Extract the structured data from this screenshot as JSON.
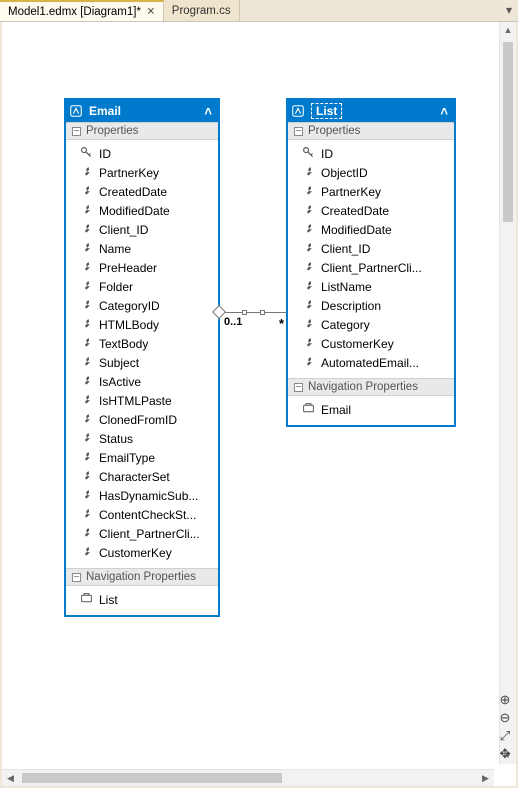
{
  "tabs": {
    "active": "Model1.edmx [Diagram1]*",
    "inactive": "Program.cs"
  },
  "entity_email": {
    "title": "Email",
    "section_props": "Properties",
    "section_nav": "Navigation Properties",
    "props": [
      {
        "icon": "key",
        "name": "ID"
      },
      {
        "icon": "wrench",
        "name": "PartnerKey"
      },
      {
        "icon": "wrench",
        "name": "CreatedDate"
      },
      {
        "icon": "wrench",
        "name": "ModifiedDate"
      },
      {
        "icon": "wrench",
        "name": "Client_ID"
      },
      {
        "icon": "wrench",
        "name": "Name"
      },
      {
        "icon": "wrench",
        "name": "PreHeader"
      },
      {
        "icon": "wrench",
        "name": "Folder"
      },
      {
        "icon": "wrench",
        "name": "CategoryID"
      },
      {
        "icon": "wrench",
        "name": "HTMLBody"
      },
      {
        "icon": "wrench",
        "name": "TextBody"
      },
      {
        "icon": "wrench",
        "name": "Subject"
      },
      {
        "icon": "wrench",
        "name": "IsActive"
      },
      {
        "icon": "wrench",
        "name": "IsHTMLPaste"
      },
      {
        "icon": "wrench",
        "name": "ClonedFromID"
      },
      {
        "icon": "wrench",
        "name": "Status"
      },
      {
        "icon": "wrench",
        "name": "EmailType"
      },
      {
        "icon": "wrench",
        "name": "CharacterSet"
      },
      {
        "icon": "wrench",
        "name": "HasDynamicSub..."
      },
      {
        "icon": "wrench",
        "name": "ContentCheckSt..."
      },
      {
        "icon": "wrench",
        "name": "Client_PartnerCli..."
      },
      {
        "icon": "wrench",
        "name": "CustomerKey"
      }
    ],
    "nav": [
      {
        "name": "List"
      }
    ]
  },
  "entity_list": {
    "title": "List",
    "section_props": "Properties",
    "section_nav": "Navigation Properties",
    "props": [
      {
        "icon": "key",
        "name": "ID"
      },
      {
        "icon": "wrench",
        "name": "ObjectID"
      },
      {
        "icon": "wrench",
        "name": "PartnerKey"
      },
      {
        "icon": "wrench",
        "name": "CreatedDate"
      },
      {
        "icon": "wrench",
        "name": "ModifiedDate"
      },
      {
        "icon": "wrench",
        "name": "Client_ID"
      },
      {
        "icon": "wrench",
        "name": "Client_PartnerCli..."
      },
      {
        "icon": "wrench",
        "name": "ListName"
      },
      {
        "icon": "wrench",
        "name": "Description"
      },
      {
        "icon": "wrench",
        "name": "Category"
      },
      {
        "icon": "wrench",
        "name": "CustomerKey"
      },
      {
        "icon": "wrench",
        "name": "AutomatedEmail..."
      }
    ],
    "nav": [
      {
        "name": "Email"
      }
    ]
  },
  "relation": {
    "left_mult": "0..1",
    "right_mult": "*"
  }
}
